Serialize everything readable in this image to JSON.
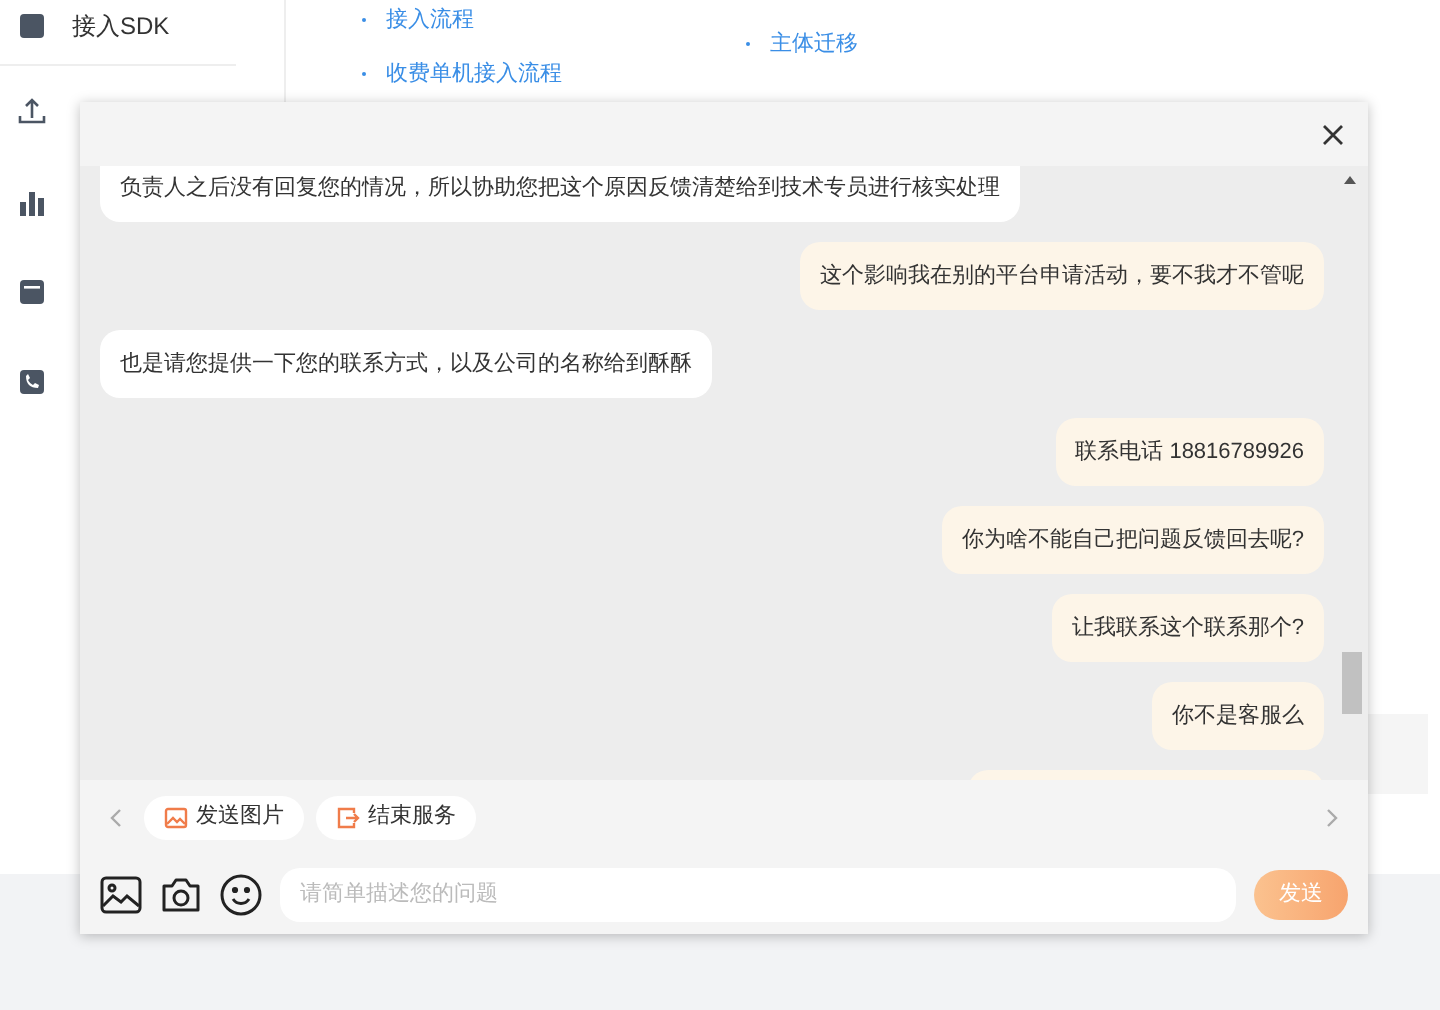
{
  "sidebar": {
    "items": [
      {
        "label": "接入SDK",
        "kind": "block"
      },
      {
        "kind": "upload"
      },
      {
        "kind": "chart"
      },
      {
        "kind": "wallet"
      },
      {
        "kind": "phone"
      }
    ]
  },
  "links": {
    "column_1": [
      "接入流程",
      "收费单机接入流程"
    ],
    "column_2": [
      "主体迁移"
    ]
  },
  "chat": {
    "messages": [
      {
        "kind": "agent",
        "text": "负责人之后没有回复您的情况，所以协助您把这个原因反馈清楚给到技术专员进行核实处理"
      },
      {
        "kind": "user",
        "text": "这个影响我在别的平台申请活动，要不我才不管呢"
      },
      {
        "kind": "agent",
        "text": "也是请您提供一下您的联系方式，以及公司的名称给到酥酥"
      },
      {
        "kind": "user",
        "text": "联系电话 18816789926"
      },
      {
        "kind": "user",
        "text": "你为啥不能自己把问题反馈回去呢?"
      },
      {
        "kind": "user",
        "text": "让我联系这个联系那个?"
      },
      {
        "kind": "user",
        "text": "你不是客服么"
      }
    ],
    "quick_actions": [
      {
        "label": "发送图片",
        "kind": "image"
      },
      {
        "label": "结束服务",
        "kind": "exit"
      }
    ],
    "input": {
      "placeholder": "请简单描述您的问题"
    },
    "send_button": "发送"
  }
}
